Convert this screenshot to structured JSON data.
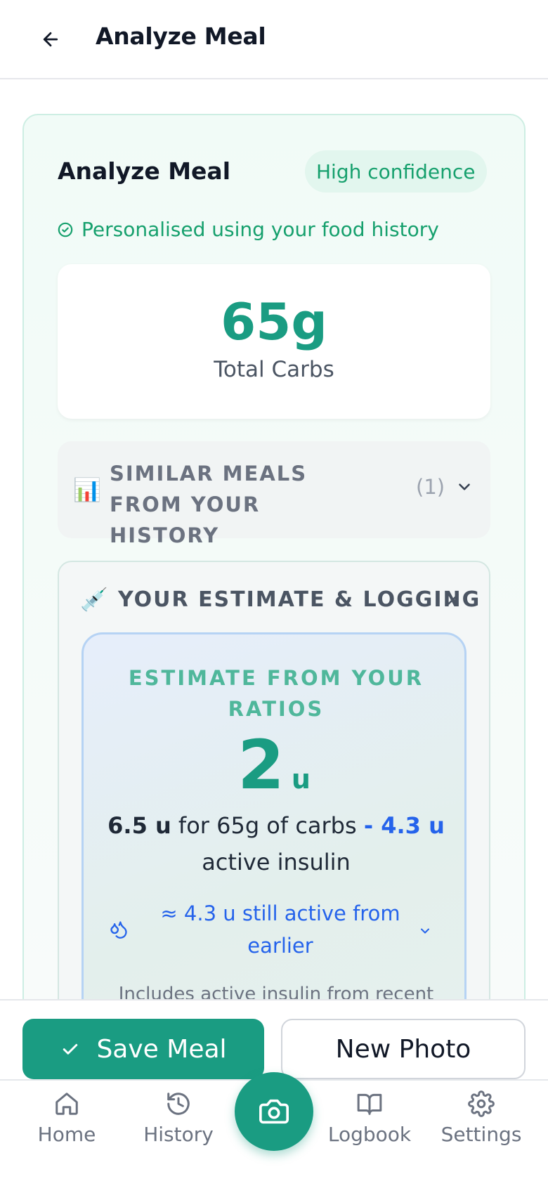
{
  "header": {
    "title": "Analyze Meal"
  },
  "card": {
    "title": "Analyze Meal",
    "confidence_badge": "High confidence",
    "personalised_note": "Personalised using your food history",
    "carbs": {
      "value": "65g",
      "label": "Total Carbs"
    },
    "similar_meals": {
      "label": "SIMILAR MEALS FROM YOUR HISTORY",
      "count": "(1)"
    },
    "estimate": {
      "heading": "YOUR ESTIMATE & LOGGING",
      "ratio_label": "ESTIMATE FROM YOUR RATIOS",
      "units_value": "2",
      "units_suffix": "u",
      "calc_dose": "6.5 u",
      "calc_mid": " for 65g of carbs ",
      "calc_active": "- 4.3 u",
      "calc_tail": " active insulin",
      "active_note": "≈ 4.3 u still active from earlier",
      "footnote": "Includes active insulin from recent"
    }
  },
  "actions": {
    "save_label": "Save Meal",
    "new_photo_label": "New Photo"
  },
  "nav": {
    "home": "Home",
    "history": "History",
    "logbook": "Logbook",
    "settings": "Settings"
  },
  "colors": {
    "accent": "#1a9c82",
    "confidence": "#16a06d",
    "insulin_blue": "#2563eb"
  }
}
